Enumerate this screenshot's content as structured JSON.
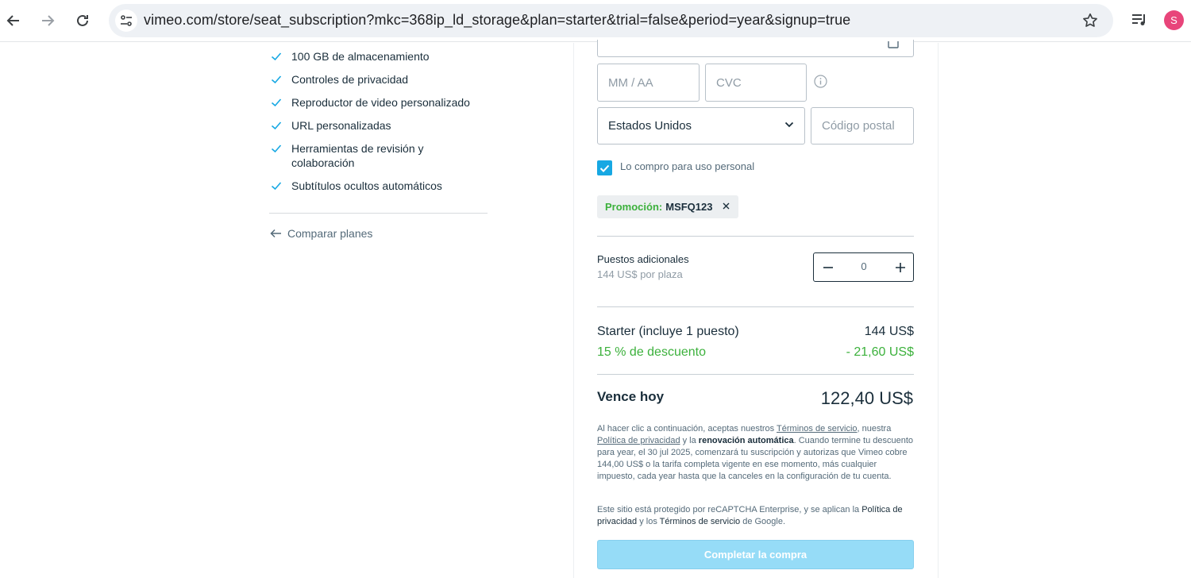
{
  "browser": {
    "url": "vimeo.com/store/seat_subscription?mkc=368ip_ld_storage&plan=starter&trial=false&period=year&signup=true",
    "profile_initial": "S"
  },
  "features": [
    "100 GB de almacenamiento",
    "Controles de privacidad",
    "Reproductor de video personalizado",
    "URL personalizadas",
    "Herramientas de revisión y colaboración",
    "Subtítulos ocultos automáticos"
  ],
  "compare_link": "Comparar planes",
  "form": {
    "expiry_placeholder": "MM / AA",
    "cvc_placeholder": "CVC",
    "country_selected": "Estados Unidos",
    "postal_placeholder": "Código postal",
    "personal_use_label": "Lo compro para uso personal",
    "personal_use_checked": true
  },
  "promo": {
    "label": "Promoción:",
    "code": "MSFQ123"
  },
  "seats": {
    "title": "Puestos adicionales",
    "price_per_seat": "144 US$ por plaza",
    "count": "0"
  },
  "summary": {
    "plan_label": "Starter (incluye 1 puesto)",
    "plan_price": "144 US$",
    "discount_label": "15 % de descuento",
    "discount_amount": "- 21,60 US$",
    "due_label": "Vence hoy",
    "due_amount": "122,40 US$"
  },
  "legal": {
    "p1_a": "Al hacer clic a continuación, aceptas nuestros ",
    "terms_link": "Términos de servicio",
    "p1_b": ", nuestra ",
    "privacy_link": "Política de privacidad",
    "p1_c": " y la ",
    "auto_renew": "renovación automática",
    "p1_d": ". Cuando termine tu descuento para year, el 30 jul 2025, comenzará tu suscripción y autorizas que Vimeo cobre 144,00 US$ o la tarifa completa vigente en ese momento, más cualquier impuesto, cada year hasta que la canceles en la configuración de tu cuenta.",
    "p2_a": "Este sitio está protegido por reCAPTCHA Enterprise, y se aplican la ",
    "p2_privacy": "Política de privacidad",
    "p2_b": " y los ",
    "p2_terms": "Términos de servicio",
    "p2_c": " de Google."
  },
  "submit_label": "Completar la compra",
  "colors": {
    "accent": "#17a8e3",
    "green": "#3cb13c",
    "submit_disabled": "#96dcf7"
  }
}
